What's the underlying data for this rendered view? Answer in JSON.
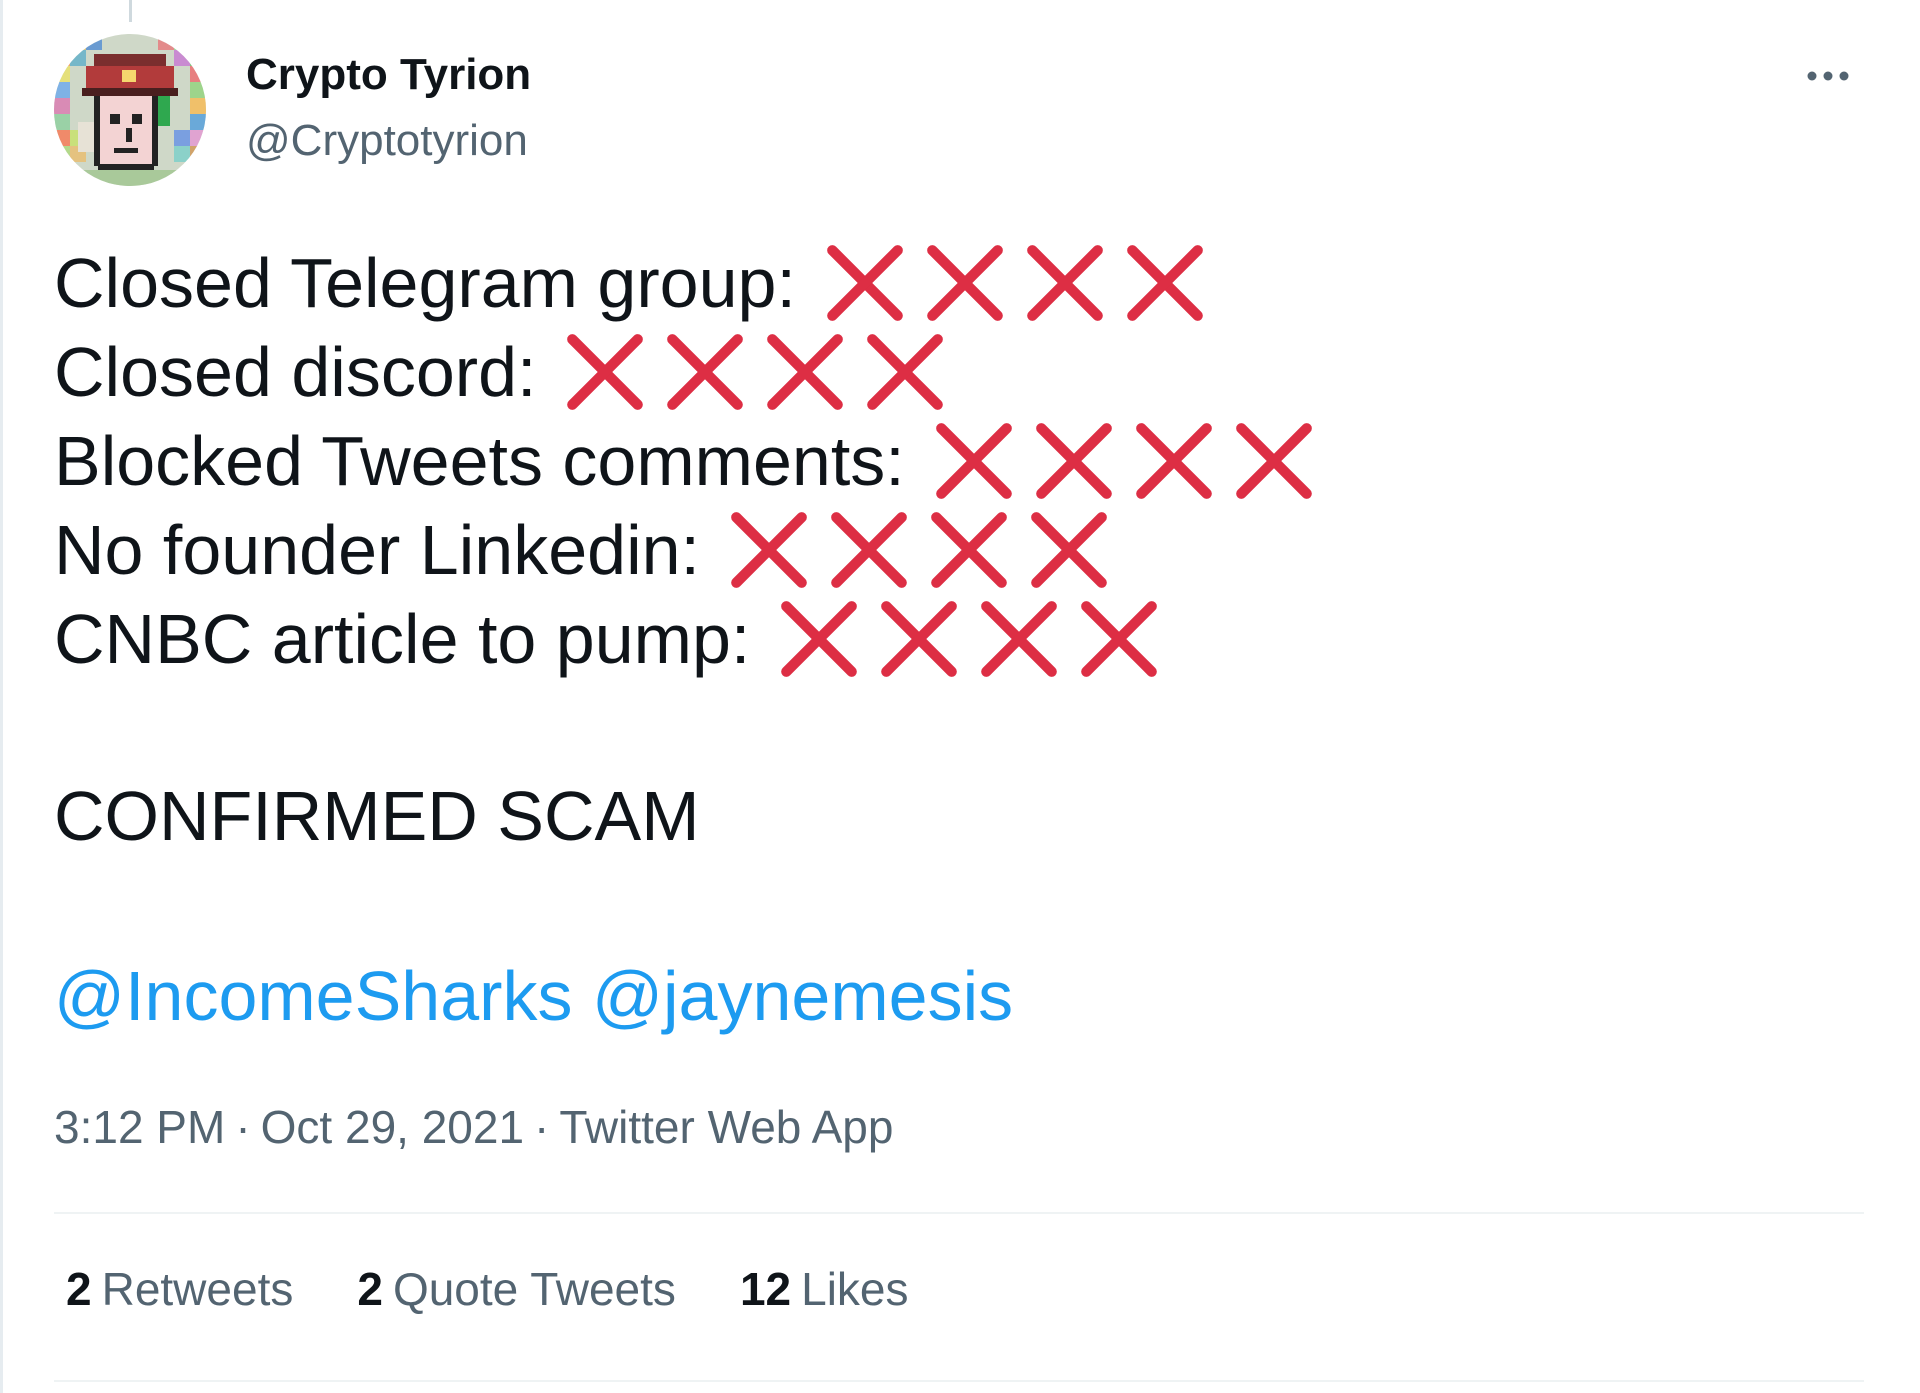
{
  "tweet": {
    "author": {
      "name": "Crypto Tyrion",
      "handle": "@Cryptotyrion",
      "avatar_icon": "pixel-punk-avatar"
    },
    "more_icon": "more-horizontal-icon",
    "lines": [
      {
        "text": "Closed Telegram group:",
        "marks": 4
      },
      {
        "text": "Closed discord:",
        "marks": 4
      },
      {
        "text": "Blocked Tweets comments:",
        "marks": 4
      },
      {
        "text": "No founder Linkedin:",
        "marks": 4
      },
      {
        "text": "CNBC article to pump:",
        "marks": 4
      }
    ],
    "mark_icon": "red-cross-mark-icon",
    "mark_color": "#dd2e44",
    "conclusion": "CONFIRMED SCAM",
    "mentions": [
      "@IncomeSharks",
      "@jaynemesis"
    ],
    "mention_color": "#1d9bf0",
    "time": "3:12 PM",
    "date": "Oct 29, 2021",
    "source": "Twitter Web App",
    "separator": "·",
    "stats": {
      "retweets_count": "2",
      "retweets_label": "Retweets",
      "quotes_count": "2",
      "quotes_label": "Quote Tweets",
      "likes_count": "12",
      "likes_label": "Likes"
    }
  }
}
